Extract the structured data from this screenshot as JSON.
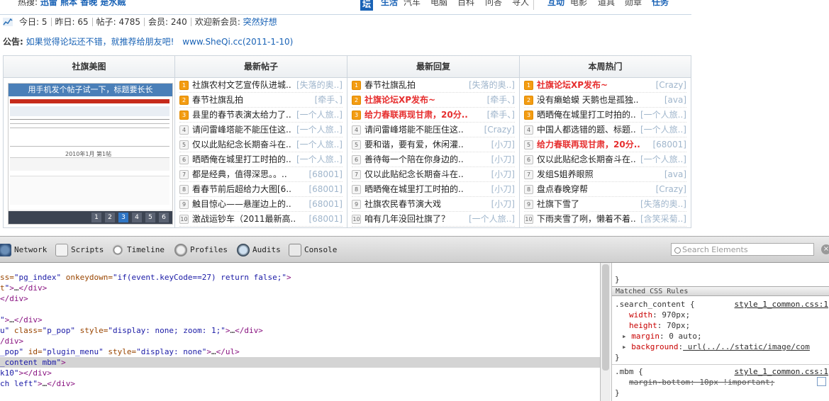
{
  "topbar": {
    "hot_label": "热搜:",
    "hot_links": "迅雷 熊本 香晚 是水贼",
    "tan": "坛",
    "cats_left": [
      "生活",
      "汽车",
      "电脑",
      "百科",
      "问答",
      "寻人"
    ],
    "cats_right": [
      "互动",
      "电影",
      "道具",
      "勋章",
      "任务"
    ]
  },
  "stats": {
    "today": "今日: 5",
    "yesterday": "昨日: 65",
    "posts": "帖子: 4785",
    "members": "会员: 240",
    "welcome_label": "欢迎新会员: ",
    "new_member": "突然好想"
  },
  "notice": {
    "label": "公告:",
    "text": "如果觉得论坛还不错，就推荐给朋友吧!",
    "url": "www.SheQi.cc(2011-1-10)"
  },
  "boxes": {
    "pic_header": "社旗美图",
    "new_header": "最新帖子",
    "reply_header": "最新回复",
    "hot_header": "本周热门",
    "slider_caption": "用手机发个帖子试一下，标题要长长",
    "slider_inner": "2010年1月 第1帖",
    "slider_pages": [
      "1",
      "2",
      "3",
      "4",
      "5",
      "6"
    ],
    "slider_active": 3,
    "new_posts": [
      {
        "n": "1",
        "title": "社旗农村文艺宣传队进城..",
        "author": "[失落的奥..]",
        "top": true,
        "red": false
      },
      {
        "n": "2",
        "title": "春节社旗乱拍",
        "author": "[牵手、]",
        "top": true,
        "red": false
      },
      {
        "n": "3",
        "title": "县里的春节表演太给力了..",
        "author": "[一个人旅..]",
        "top": true,
        "red": false
      },
      {
        "n": "4",
        "title": "请问雷峰塔能不能压住这..",
        "author": "[一个人旅..]",
        "top": false,
        "red": false
      },
      {
        "n": "5",
        "title": "仅以此贴纪念长期奋斗在..",
        "author": "[一个人旅..]",
        "top": false,
        "red": false
      },
      {
        "n": "6",
        "title": "晒晒俺在城里打工时拍的..",
        "author": "[一个人旅..]",
        "top": false,
        "red": false
      },
      {
        "n": "7",
        "title": "都是经典，值得深思。。..",
        "author": "[68001]",
        "top": false,
        "red": false
      },
      {
        "n": "8",
        "title": "看春节前后超给力大图[6..",
        "author": "[68001]",
        "top": false,
        "red": false
      },
      {
        "n": "9",
        "title": "触目惊心——悬崖边上的..",
        "author": "[68001]",
        "top": false,
        "red": false
      },
      {
        "n": "10",
        "title": "激战运钞车（2011最新高..",
        "author": "[68001]",
        "top": false,
        "red": false
      }
    ],
    "new_replies": [
      {
        "n": "1",
        "title": "春节社旗乱拍",
        "author": "[失落的奥..]",
        "top": true,
        "red": false
      },
      {
        "n": "2",
        "title": "社旗论坛XP发布~",
        "author": "[牵手、]",
        "top": true,
        "red": true
      },
      {
        "n": "3",
        "title": "给力春联再现甘肃，20分..",
        "author": "[牵手、]",
        "top": true,
        "red": true
      },
      {
        "n": "4",
        "title": "请问雷峰塔能不能压住这..",
        "author": "[Crazy]",
        "top": false,
        "red": false
      },
      {
        "n": "5",
        "title": "要和谐，要有爱，休闲灌..",
        "author": "[小刀]",
        "top": false,
        "red": false
      },
      {
        "n": "6",
        "title": "善待每一个陪在你身边的..",
        "author": "[小刀]",
        "top": false,
        "red": false
      },
      {
        "n": "7",
        "title": "仅以此贴纪念长期奋斗在..",
        "author": "[小刀]",
        "top": false,
        "red": false
      },
      {
        "n": "8",
        "title": "晒晒俺在城里打工时拍的..",
        "author": "[小刀]",
        "top": false,
        "red": false
      },
      {
        "n": "9",
        "title": "社旗农民春节演大戏",
        "author": "[小刀]",
        "top": false,
        "red": false
      },
      {
        "n": "10",
        "title": "咱有几年没回社旗了？",
        "author": "[一个人旅..]",
        "top": false,
        "red": false
      }
    ],
    "hot_posts": [
      {
        "n": "1",
        "title": "社旗论坛XP发布~",
        "author": "[Crazy]",
        "top": true,
        "red": true
      },
      {
        "n": "2",
        "title": "没有癞蛤蟆 天鹅也是孤独..",
        "author": "[ava]",
        "top": true,
        "red": false
      },
      {
        "n": "3",
        "title": "晒晒俺在城里打工时拍的..",
        "author": "[一个人旅..]",
        "top": true,
        "red": false
      },
      {
        "n": "4",
        "title": "中国人都选错的题、标题..",
        "author": "[一个人旅..]",
        "top": false,
        "red": false
      },
      {
        "n": "5",
        "title": "给力春联再现甘肃，20分..",
        "author": "[68001]",
        "top": false,
        "red": true
      },
      {
        "n": "6",
        "title": "仅以此贴纪念长期奋斗在..",
        "author": "[一个人旅..]",
        "top": false,
        "red": false
      },
      {
        "n": "7",
        "title": "发组S姐养眼照",
        "author": "[ava]",
        "top": false,
        "red": false
      },
      {
        "n": "8",
        "title": "盘点春晚穿帮",
        "author": "[Crazy]",
        "top": false,
        "red": false
      },
      {
        "n": "9",
        "title": "社旗下雪了",
        "author": "[失落的奥..]",
        "top": false,
        "red": false
      },
      {
        "n": "10",
        "title": "下雨夹雪了咧，懒着不着..",
        "author": "[含笑采菊..]",
        "top": false,
        "red": false
      }
    ]
  },
  "devtools": {
    "tabs": [
      "Network",
      "Scripts",
      "Timeline",
      "Profiles",
      "Audits",
      "Console"
    ],
    "search_placeholder": "Search Elements",
    "close": "×",
    "dom_lines": [
      {
        "parts": [
          [
            "attr",
            "ss="
          ],
          [
            "val",
            "\"pg_index\""
          ],
          [
            "attr",
            " onkeydown="
          ],
          [
            "val",
            "\"if(event.keyCode==27) return false;\""
          ],
          [
            "tag",
            ">"
          ]
        ]
      },
      {
        "parts": [
          [
            "attr",
            "t"
          ],
          [
            "val",
            "\""
          ],
          [
            "tag",
            ">"
          ],
          [
            "txt",
            "…"
          ],
          [
            "tag",
            "</div>"
          ]
        ]
      },
      {
        "parts": [
          [
            "tag",
            "</div>"
          ]
        ]
      },
      {
        "parts": [
          [
            "txt",
            " "
          ]
        ]
      },
      {
        "parts": [
          [
            "val",
            "\""
          ],
          [
            "tag",
            ">"
          ],
          [
            "txt",
            "…"
          ],
          [
            "tag",
            "</div>"
          ]
        ]
      },
      {
        "parts": [
          [
            "val",
            "u\""
          ],
          [
            "attr",
            " class="
          ],
          [
            "val",
            "\"p_pop\""
          ],
          [
            "attr",
            " style="
          ],
          [
            "val",
            "\"display: none; zoom: 1;\""
          ],
          [
            "tag",
            ">"
          ],
          [
            "txt",
            "…"
          ],
          [
            "tag",
            "</div>"
          ]
        ]
      },
      {
        "parts": [
          [
            "tag",
            "/div>"
          ]
        ]
      },
      {
        "parts": [
          [
            "val",
            "_pop\""
          ],
          [
            "attr",
            " id="
          ],
          [
            "val",
            "\"plugin_menu\""
          ],
          [
            "attr",
            " style="
          ],
          [
            "val",
            "\"display: none\""
          ],
          [
            "tag",
            ">"
          ],
          [
            "txt",
            "…"
          ],
          [
            "tag",
            "</ul>"
          ]
        ]
      },
      {
        "parts": [
          [
            "val",
            "_content mbm\""
          ],
          [
            "tag",
            ">"
          ]
        ]
      },
      {
        "parts": [
          [
            "val",
            "k10\""
          ],
          [
            "tag",
            ">"
          ],
          [
            "tag",
            "</div>"
          ]
        ]
      },
      {
        "parts": [
          [
            "val",
            "ch left\""
          ],
          [
            "tag",
            ">"
          ],
          [
            "txt",
            "…"
          ],
          [
            "tag",
            "</div>"
          ]
        ]
      }
    ],
    "selected_dom_line": 8,
    "styles": {
      "top_brace": "}",
      "matched_header": "Matched CSS Rules",
      "rule1_selector": ".search_content {",
      "rule1_source": "style_1_common.css:1",
      "rule1_props": [
        {
          "name": "width",
          "value": " 970px;"
        },
        {
          "name": "height",
          "value": " 70px;"
        },
        {
          "name": "margin",
          "value": " 0 auto;"
        },
        {
          "name": "background",
          "value": " url(../../static/image/com"
        }
      ],
      "rule1_close": "}",
      "rule2_selector": ".mbm {",
      "rule2_source": "style_1_common.css:1",
      "rule2_prop": "margin-bottom: 10px !important;",
      "rule2_close": "}"
    }
  }
}
